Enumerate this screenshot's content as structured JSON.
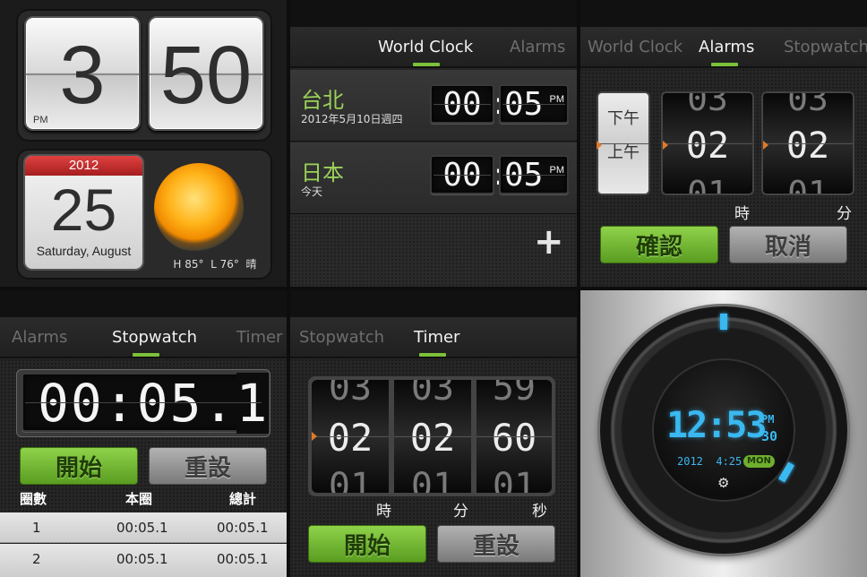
{
  "clock_widget": {
    "hour": "3",
    "minute": "50",
    "ampm": "PM",
    "year": "2012",
    "day": "25",
    "weekday_month": "Saturday, August",
    "weather": "H 85°  L 76°  晴",
    "weather_icon": "sun-icon"
  },
  "world_clock": {
    "tabs": [
      "World Clock",
      "Alarms"
    ],
    "active_tab": "World Clock",
    "cities": [
      {
        "name": "台北",
        "date": "2012年5月10日週四",
        "hours": "00",
        "minutes": "05",
        "ampm": "PM"
      },
      {
        "name": "日本",
        "date": "今天",
        "hours": "00",
        "minutes": "05",
        "ampm": "PM"
      }
    ],
    "add_label": "+"
  },
  "alarms": {
    "tabs": [
      "World Clock",
      "Alarms",
      "Stopwatch"
    ],
    "active_tab": "Alarms",
    "ampm_wheel": [
      "下午",
      "上午"
    ],
    "hour_wheel": [
      "03",
      "02",
      "01"
    ],
    "minute_wheel": [
      "03",
      "02",
      "01"
    ],
    "hour_label": "時",
    "minute_label": "分",
    "confirm_label": "確認",
    "cancel_label": "取消"
  },
  "stopwatch": {
    "tabs": [
      "Alarms",
      "Stopwatch",
      "Timer"
    ],
    "active_tab": "Stopwatch",
    "display": "00:05.",
    "display_tenth": "1",
    "start_label": "開始",
    "reset_label": "重設",
    "columns": [
      "圈數",
      "本圈",
      "總計"
    ],
    "laps": [
      {
        "lap": "1",
        "this_lap": "00:05.1",
        "total": "00:05.1"
      },
      {
        "lap": "2",
        "this_lap": "00:05.1",
        "total": "00:05.1"
      }
    ]
  },
  "timer": {
    "tabs": [
      "Stopwatch",
      "Timer"
    ],
    "active_tab": "Timer",
    "hour_wheel": [
      "03",
      "02",
      "01"
    ],
    "minute_wheel": [
      "03",
      "02",
      "01"
    ],
    "second_wheel": [
      "59",
      "60",
      "01"
    ],
    "hour_label": "時",
    "minute_label": "分",
    "second_label": "秒",
    "start_label": "開始",
    "reset_label": "重設"
  },
  "dial_clock": {
    "time": "12:53",
    "ampm": "PM",
    "seconds": "30",
    "date": "2012  4:25",
    "weekday": "MON",
    "accent": "#3ab8f0",
    "settings_icon": "gear-icon"
  },
  "colors": {
    "accent_green": "#7bc13a",
    "city_green": "#9bd25a",
    "alarm_marker": "#e07a27",
    "calendar_red": "#c62828"
  }
}
